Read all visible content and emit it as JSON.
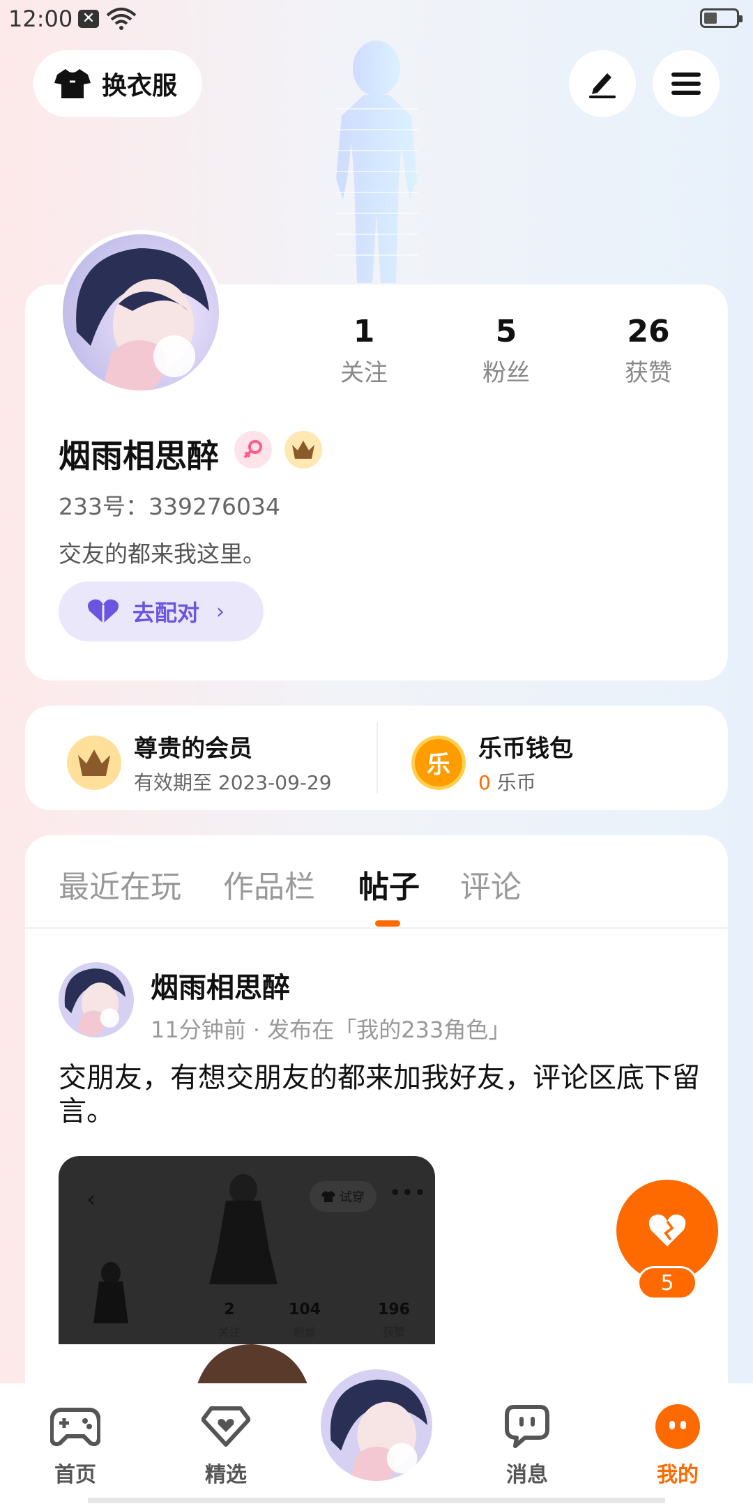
{
  "status_bar": {
    "time": "12:00"
  },
  "top_bar": {
    "outfit_label": "换衣服"
  },
  "profile": {
    "stats": [
      {
        "value": "1",
        "label": "关注"
      },
      {
        "value": "5",
        "label": "粉丝"
      },
      {
        "value": "26",
        "label": "获赞"
      }
    ],
    "username": "烟雨相思醉",
    "user_id": "233号：339276034",
    "bio": "交友的都来我这里。",
    "match_label": "去配对"
  },
  "membership": {
    "title": "尊贵的会员",
    "subtitle": "有效期至 2023-09-29"
  },
  "wallet": {
    "title": "乐币钱包",
    "coin_icon_text": "乐",
    "coin_count": "0",
    "coin_unit": "乐币"
  },
  "tabs": [
    {
      "label": "最近在玩"
    },
    {
      "label": "作品栏"
    },
    {
      "label": "帖子"
    },
    {
      "label": "评论"
    }
  ],
  "post": {
    "author": "烟雨相思醉",
    "meta": "11分钟前 · 发布在「我的233角色」",
    "text": "交朋友，有想交朋友的都来加我好友，评论区底下留言。",
    "image": {
      "try_label": "试穿",
      "stats": [
        {
          "value": "2",
          "label": "关注"
        },
        {
          "value": "104",
          "label": "粉丝"
        },
        {
          "value": "196",
          "label": "获赞"
        }
      ]
    }
  },
  "like_count": "5",
  "bottom_nav": [
    {
      "label": "首页"
    },
    {
      "label": "精选"
    },
    {
      "label": "消息"
    },
    {
      "label": "我的"
    }
  ],
  "colors": {
    "accent": "#ff6a00",
    "purple": "#6a55e0"
  }
}
